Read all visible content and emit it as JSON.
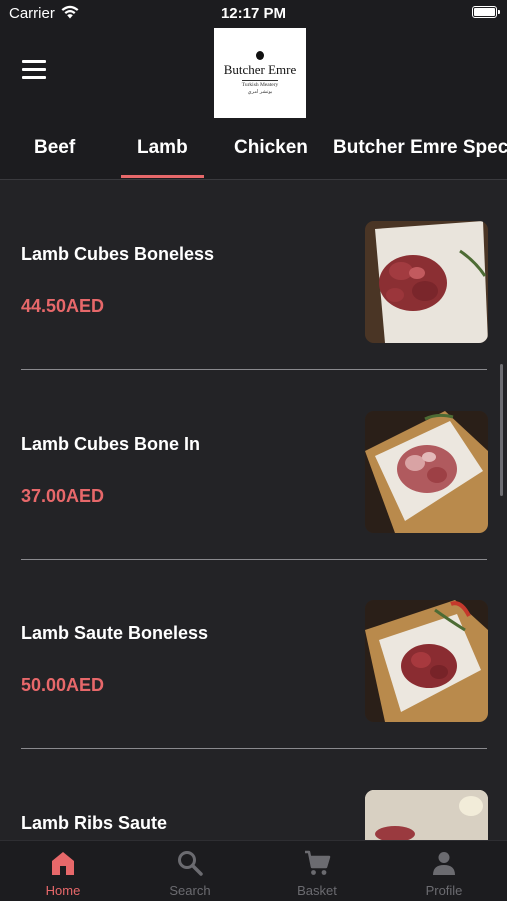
{
  "status_bar": {
    "carrier": "Carrier",
    "time": "12:17 PM"
  },
  "header": {
    "menu_icon": "hamburger-menu-icon",
    "logo": {
      "name": "Butcher Emre",
      "tagline": "Turkish Meatery",
      "tagline_ar": "بوتشر امري"
    }
  },
  "category_tabs": [
    {
      "label": "Beef",
      "active": false
    },
    {
      "label": "Lamb",
      "active": true
    },
    {
      "label": "Chicken",
      "active": false
    },
    {
      "label": "Butcher Emre Spec",
      "active": false
    }
  ],
  "colors": {
    "accent": "#e7686a",
    "background": "#232326",
    "bar": "#1c1c1f",
    "inactive": "#6b6b70"
  },
  "products": [
    {
      "name": "Lamb Cubes Boneless",
      "price": "44.50AED"
    },
    {
      "name": "Lamb Cubes Bone In",
      "price": "37.00AED"
    },
    {
      "name": "Lamb Saute Boneless",
      "price": "50.00AED"
    },
    {
      "name": "Lamb Ribs Saute",
      "price": ""
    }
  ],
  "bottom_tabs": [
    {
      "label": "Home",
      "icon": "home-icon",
      "active": true
    },
    {
      "label": "Search",
      "icon": "search-icon",
      "active": false
    },
    {
      "label": "Basket",
      "icon": "cart-icon",
      "active": false
    },
    {
      "label": "Profile",
      "icon": "profile-icon",
      "active": false
    }
  ]
}
